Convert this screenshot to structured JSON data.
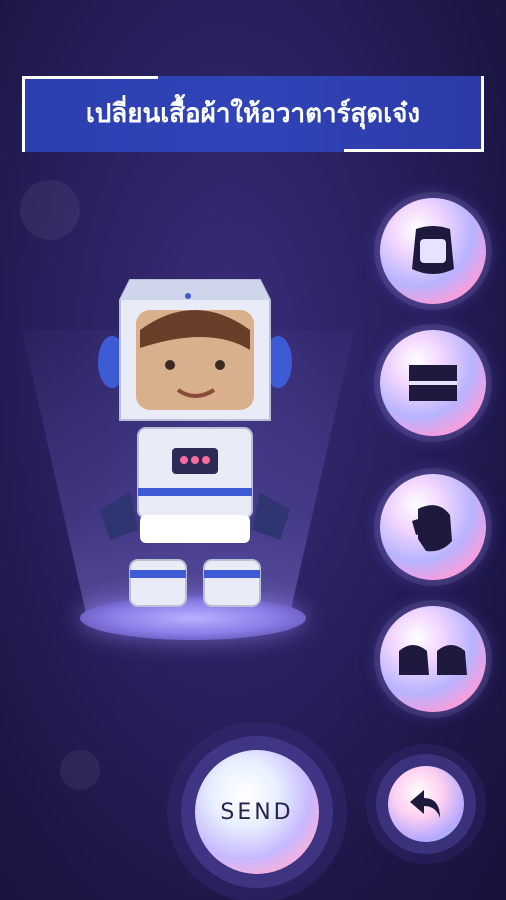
{
  "header": {
    "title": "เปลี่ยนเสื้อผ้าให้อวาตาร์สุดเจ๋ง"
  },
  "category_buttons": [
    {
      "icon": "helmet-icon"
    },
    {
      "icon": "suit-icon"
    },
    {
      "icon": "glove-icon"
    },
    {
      "icon": "boots-icon"
    }
  ],
  "actions": {
    "send_label": "SEND",
    "back_icon": "undo-arrow-icon"
  },
  "colors": {
    "background": "#1d1747",
    "title_bar": "#3044b8",
    "accent": "#b8b3ff"
  }
}
